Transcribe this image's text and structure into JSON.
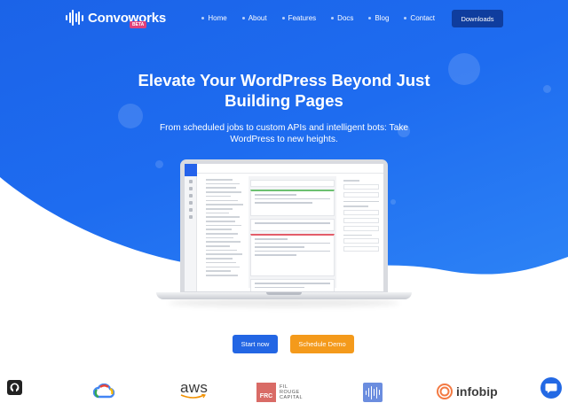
{
  "header": {
    "logo_text": "Convoworks",
    "beta_badge": "BETA",
    "nav": [
      "Home",
      "About",
      "Features",
      "Docs",
      "Blog",
      "Contact"
    ],
    "downloads_label": "Downloads"
  },
  "hero": {
    "title_line1": "Elevate Your WordPress Beyond Just",
    "title_line2": "Building Pages",
    "subtitle_line1": "From scheduled jobs to custom APIs and intelligent bots: Take",
    "subtitle_line2": "WordPress to new heights."
  },
  "cta": {
    "start_label": "Start now",
    "demo_label": "Schedule Demo"
  },
  "partners": {
    "aws": "aws",
    "frc_badge": "FRC",
    "frc_name_1": "FIL",
    "frc_name_2": "ROUGE",
    "frc_name_3": "CAPITAL",
    "infobip": "infobip"
  },
  "colors": {
    "hero_blue": "#1e6cf0",
    "downloads_bg": "#0f3d9e",
    "start_btn": "#2366e4",
    "demo_btn": "#f49a1b"
  },
  "icons": [
    "github-icon",
    "google-cloud-icon",
    "aws-icon",
    "frc-logo-icon",
    "sound-waves-icon",
    "infobip-icon",
    "chat-icon"
  ]
}
